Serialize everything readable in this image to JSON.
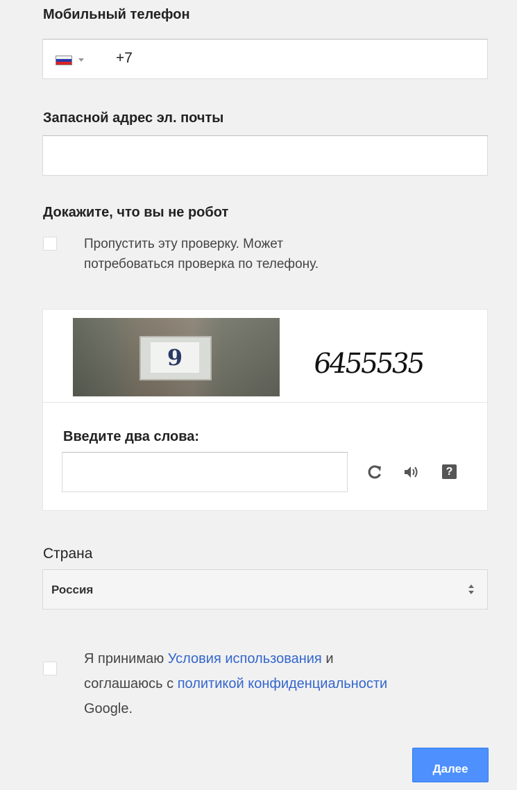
{
  "phone": {
    "label": "Мобильный телефон",
    "country_code": "+7",
    "flag": "russia-flag-icon"
  },
  "backup_email": {
    "label": "Запасной адрес эл. почты",
    "value": ""
  },
  "robot_check": {
    "heading": "Докажите, что вы не робот",
    "skip_line1": "Пропустить эту проверку. Может",
    "skip_line2": "потребоваться проверка по телефону."
  },
  "captcha": {
    "photo_text": "9",
    "word_text": "6455535",
    "input_label": "Введите два слова:",
    "input_value": "",
    "icons": [
      "refresh-icon",
      "audio-icon",
      "help-icon"
    ],
    "help_glyph": "?"
  },
  "country": {
    "label": "Страна",
    "selected": "Россия"
  },
  "terms": {
    "prefix": "Я принимаю ",
    "terms_link": "Условия использования",
    "and": " и",
    "line2_prefix": "соглашаюсь с ",
    "privacy_link": "политикой конфиденциальности",
    "line3": "Google."
  },
  "next_button": "Далее",
  "colors": {
    "primary_button": "#4d90fe",
    "link": "#3366cc"
  }
}
